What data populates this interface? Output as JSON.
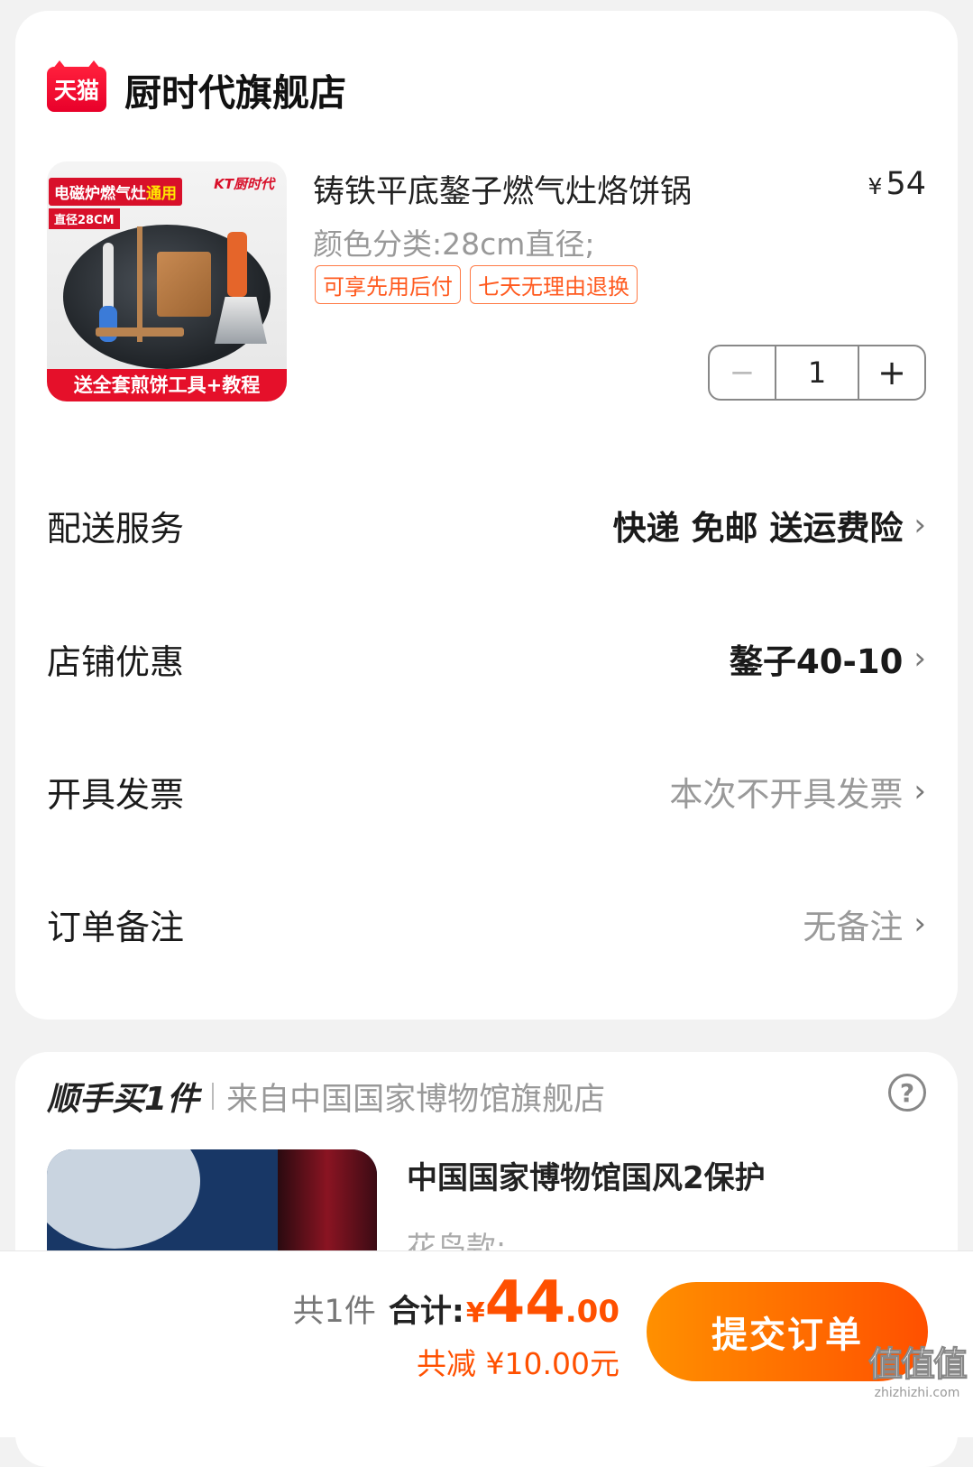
{
  "store": {
    "logo_text": "天猫",
    "name": "厨时代旗舰店"
  },
  "product": {
    "image": {
      "tag_main": "电磁炉燃气灶",
      "tag_highlight": "通用",
      "tag_size": "直径28CM",
      "brand": "KT厨时代",
      "banner": "送全套煎饼工具+教程"
    },
    "title": "铸铁平底鏊子燃气灶烙饼锅",
    "currency": "¥",
    "price": "54",
    "spec": "颜色分类:28cm直径;",
    "tags": [
      "可享先用后付",
      "七天无理由退换"
    ],
    "quantity": "1",
    "minus": "−",
    "plus": "+"
  },
  "rows": [
    {
      "label": "配送服务",
      "value": "快递 免邮 送运费险",
      "style": "bold"
    },
    {
      "label": "店铺优惠",
      "value": "鏊子40-10",
      "style": "bold"
    },
    {
      "label": "开具发票",
      "value": "本次不开具发票",
      "style": "muted"
    },
    {
      "label": "订单备注",
      "value": "无备注",
      "style": "muted"
    }
  ],
  "chevron": "›",
  "addon": {
    "title": "顺手买1件",
    "source": "来自中国国家博物馆旗舰店",
    "help": "?",
    "item_name": "中国国家博物馆国风2保护",
    "item_spec": "花鸟款;"
  },
  "bottom": {
    "count": "共1件",
    "total_label": "合计:",
    "currency": "¥",
    "total_int": "44",
    "total_dec": ".00",
    "discount": "共减 ¥10.00元",
    "submit": "提交订单"
  },
  "watermark": {
    "logo": "值值值",
    "site": "zhizhizhi.com"
  }
}
